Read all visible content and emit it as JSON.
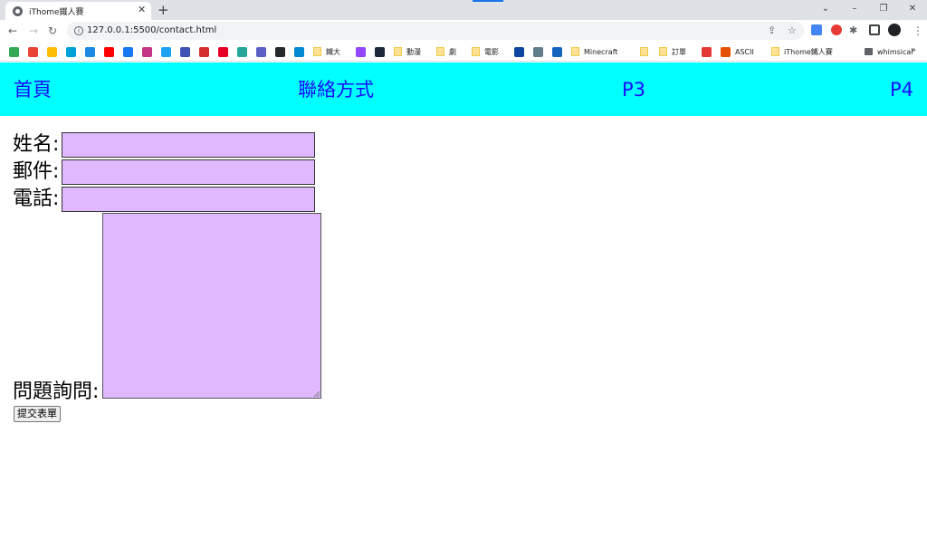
{
  "browser": {
    "tab_title": "iThome鐵人賽",
    "tab_close": "✕",
    "new_tab": "+",
    "url": "127.0.0.1:5500/contact.html",
    "window_controls": [
      "⌄",
      "–",
      "❐",
      "✕"
    ],
    "bookmarks": [
      {
        "label": "",
        "icon": "google-drive-icon",
        "color": "#34a853"
      },
      {
        "label": "",
        "icon": "gmail-icon",
        "color": "#ea4335"
      },
      {
        "label": "",
        "icon": "google-photos-icon",
        "color": "#fbbc04"
      },
      {
        "label": "",
        "icon": "bilibili-icon",
        "color": "#00a1d6"
      },
      {
        "label": "",
        "icon": "app-icon",
        "color": "#1e88e5"
      },
      {
        "label": "",
        "icon": "youtube-icon",
        "color": "#ff0000"
      },
      {
        "label": "",
        "icon": "facebook-icon",
        "color": "#1877f2"
      },
      {
        "label": "",
        "icon": "instagram-icon",
        "color": "#c13584"
      },
      {
        "label": "",
        "icon": "twitter-icon",
        "color": "#1da1f2"
      },
      {
        "label": "",
        "icon": "app-icon-2",
        "color": "#3f51b5"
      },
      {
        "label": "",
        "icon": "app-icon-3",
        "color": "#d32f2f"
      },
      {
        "label": "",
        "icon": "pinterest-icon",
        "color": "#e60023"
      },
      {
        "label": "",
        "icon": "app-icon-4",
        "color": "#26a69a"
      },
      {
        "label": "",
        "icon": "teams-icon",
        "color": "#5b5fc7"
      },
      {
        "label": "",
        "icon": "github-icon",
        "color": "#24292e"
      },
      {
        "label": "",
        "icon": "app-icon-5",
        "color": "#0288d1"
      },
      {
        "label": "鐵大",
        "icon": "folder-icon"
      },
      {
        "label": "",
        "icon": "twitch-icon",
        "color": "#9146ff"
      },
      {
        "label": "",
        "icon": "steam-icon",
        "color": "#1b2838"
      },
      {
        "label": "動漫",
        "icon": "folder-icon"
      },
      {
        "label": "劇",
        "icon": "folder-icon"
      },
      {
        "label": "電影",
        "icon": "folder-icon"
      },
      {
        "label": "",
        "icon": "app-icon-6",
        "color": "#0d47a1"
      },
      {
        "label": "",
        "icon": "app-icon-7",
        "color": "#607d8b"
      },
      {
        "label": "",
        "icon": "app-icon-8",
        "color": "#1565c0"
      },
      {
        "label": "Minecraft",
        "icon": "folder-icon"
      },
      {
        "label": "",
        "icon": "folder-icon"
      },
      {
        "label": "訂單",
        "icon": "folder-icon"
      },
      {
        "label": "",
        "icon": "shopping-icon",
        "color": "#e53935"
      },
      {
        "label": "ASCII",
        "icon": "app-icon-9",
        "color": "#e65100"
      },
      {
        "label": "iThome鐵人賽",
        "icon": "folder-icon"
      },
      {
        "label": "whimsical",
        "icon": "folder-dark-icon"
      }
    ],
    "bookmarks_more": "»"
  },
  "navbar": {
    "items": [
      "首頁",
      "聯絡方式",
      "P3",
      "P4"
    ],
    "background": "#00ffff",
    "link_color": "#1a0dff"
  },
  "form": {
    "name_label": "姓名:",
    "email_label": "郵件:",
    "phone_label": "電話:",
    "question_label": "問題詢問:",
    "submit_label": "提交表單",
    "field_color": "#dfb8ff"
  }
}
